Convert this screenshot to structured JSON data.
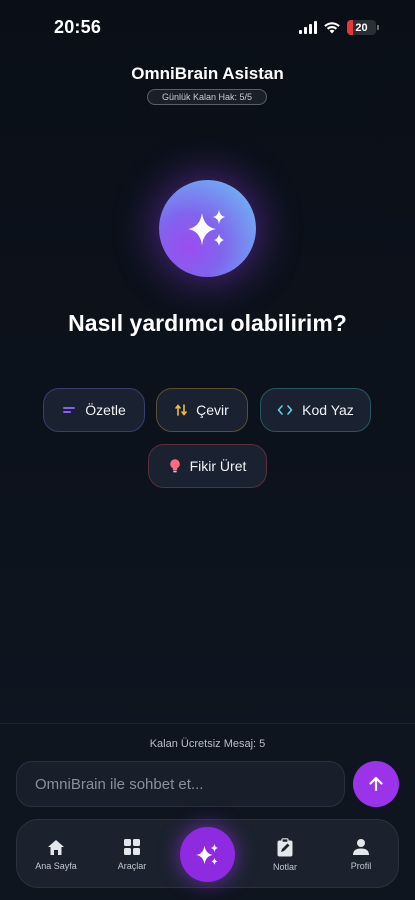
{
  "status_bar": {
    "time": "20:56",
    "battery_level": "20"
  },
  "header": {
    "title": "OmniBrain Asistan",
    "quota": "Günlük Kalan Hak: 5/5"
  },
  "hero": {
    "icon": "sparkles-icon",
    "headline": "Nasıl yardımcı olabilirim?"
  },
  "suggestions": [
    {
      "label": "Özetle",
      "icon": "summary-lines-icon",
      "color": "#8b5cf6"
    },
    {
      "label": "Çevir",
      "icon": "swap-arrows-icon",
      "color": "#f5b84a"
    },
    {
      "label": "Kod Yaz",
      "icon": "code-brackets-icon",
      "color": "#5ed3e0"
    },
    {
      "label": "Fikir Üret",
      "icon": "lightbulb-icon",
      "color": "#ff6b81"
    }
  ],
  "chat": {
    "remaining": "Kalan Ücretsiz Mesaj: 5",
    "placeholder": "OmniBrain ile sohbet et...",
    "send_color": "#9b34e8"
  },
  "tabs": {
    "home": "Ana Sayfa",
    "tools": "Araçlar",
    "notes": "Notlar",
    "profile": "Profil"
  },
  "colors": {
    "accent": "#9b34e8",
    "background": "#0c1119"
  }
}
